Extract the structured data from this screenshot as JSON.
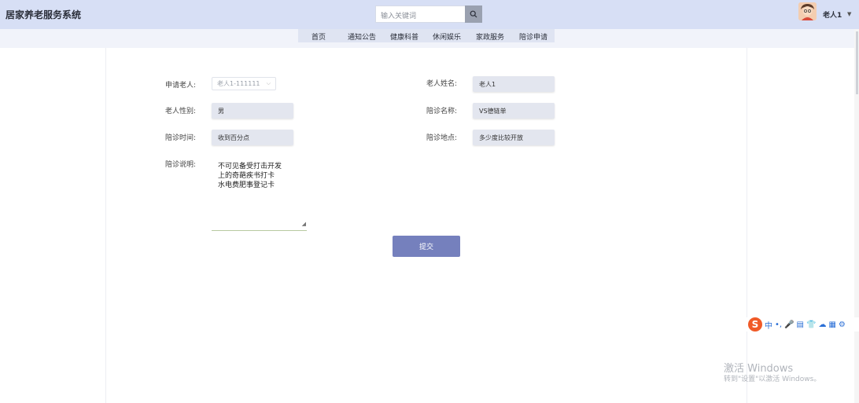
{
  "app": {
    "title": "居家养老服务系统"
  },
  "search": {
    "placeholder": "输入关键词"
  },
  "user": {
    "name": "老人1"
  },
  "nav": {
    "items": [
      "首页",
      "通知公告",
      "健康科普",
      "休闲娱乐",
      "家政服务",
      "陪诊申请"
    ]
  },
  "form": {
    "applicant": {
      "label": "申请老人:",
      "value": "老人1-111111"
    },
    "name": {
      "label": "老人姓名:",
      "value": "老人1"
    },
    "gender": {
      "label": "老人性别:",
      "value": "男"
    },
    "escort_name": {
      "label": "陪诊名称:",
      "value": "VS德链单"
    },
    "escort_time": {
      "label": "陪诊时间:",
      "value": "收到百分点"
    },
    "escort_place": {
      "label": "陪诊地点:",
      "value": "多少度比较开放"
    },
    "escort_desc": {
      "label": "陪诊说明:",
      "lines": [
        "不可见备受打击开发",
        "上的奇葩疾书打卡",
        "水电费肥事登记卡"
      ]
    },
    "submit_label": "提交"
  },
  "ime": {
    "logo": "S",
    "mode": "中",
    "items": [
      "•,",
      "🎤",
      "▤",
      "👕",
      "☁",
      "▦",
      "⚙"
    ]
  },
  "watermark": {
    "line1": "激活 Windows",
    "line2": "转到\"设置\"以激活 Windows。"
  },
  "colors": {
    "header_bg": "#d7dff5",
    "submit_bg": "#7580bd",
    "field_bg": "#e3e6ef"
  },
  "icons": {
    "search": "search-icon",
    "caret": "chevron-down-icon"
  }
}
